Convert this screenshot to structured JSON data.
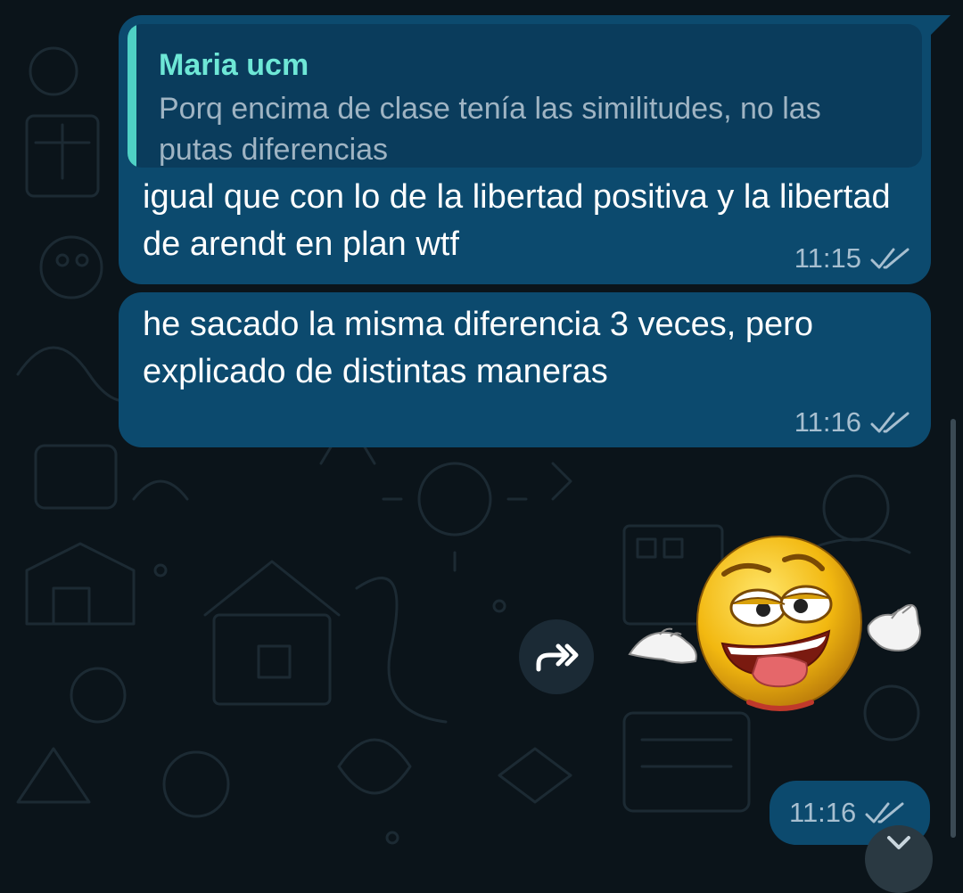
{
  "chat": {
    "messages": [
      {
        "reply_to": {
          "author": "Maria ucm",
          "text": "Porq encima de clase tenía las similitudes, no las putas diferencias"
        },
        "text": "igual que con lo de la libertad positiva y la libertad de arendt en plan wtf",
        "time": "11:15",
        "status_icon": "double-check-icon"
      },
      {
        "text": "he sacado la misma diferencia 3 veces, pero explicado de distintas maneras",
        "time": "11:16",
        "status_icon": "double-check-icon"
      },
      {
        "sticker": "laughing-emoji-sticker",
        "time": "11:16",
        "status_icon": "double-check-icon"
      }
    ]
  },
  "colors": {
    "background": "#0b141a",
    "bubble": "#0c4a6e",
    "quote_bar": "#4fd1c5",
    "quote_author": "#6ee7d6"
  },
  "icons": {
    "forward": "forward-icon",
    "scroll_down": "chevron-down-icon"
  }
}
